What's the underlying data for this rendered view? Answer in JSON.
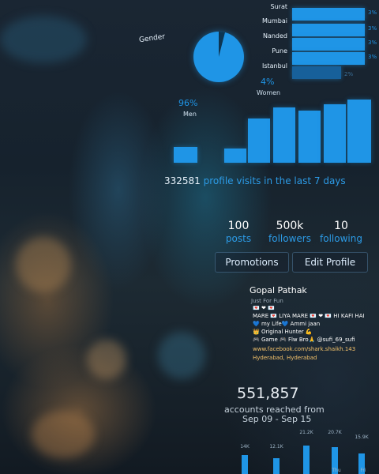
{
  "audience": {
    "gender_title": "Gender",
    "men_pct": "96%",
    "men_label": "Men",
    "women_pct": "4%",
    "women_label": "Women",
    "cities": [
      {
        "name": "Surat",
        "pct": "3%",
        "value": 3
      },
      {
        "name": "Mumbai",
        "pct": "3%",
        "value": 3
      },
      {
        "name": "Nanded",
        "pct": "3%",
        "value": 3
      },
      {
        "name": "Pune",
        "pct": "3%",
        "value": 3
      },
      {
        "name": "Istanbul",
        "pct": "2%",
        "value": 2
      }
    ]
  },
  "visits": {
    "count": "332581",
    "label": "profile visits in the last 7 days"
  },
  "stats": [
    {
      "value": "100",
      "label": "posts"
    },
    {
      "value": "500k",
      "label": "followers"
    },
    {
      "value": "10",
      "label": "following"
    }
  ],
  "buttons": {
    "promotions": "Promotions",
    "edit_profile": "Edit Profile"
  },
  "profile": {
    "name": "Gopal Pathak",
    "tagline": "Just For Fun",
    "bio_lines": [
      "💌 ❤ 💌",
      "MARE 💌 LIYA MARE 💌 ❤ 💌 HI KAFI HAI",
      "💙 my Life💙 Ammi jaan",
      "👑 Original Hunter 💪",
      "🎮 Game 🎮 Flw Bro🙏 @sufi_69_sufi"
    ],
    "link": "www.facebook.com/shark.shaikh.143",
    "location": "Hyderabad, Hyderabad"
  },
  "reach": {
    "count": "551,857",
    "label": "accounts reached from",
    "range": "Sep 09 - Sep 15"
  },
  "reach_bars": {
    "labels": [
      "14K",
      "12.1K",
      "21.2K",
      "20.7K",
      "15.9K"
    ],
    "values": [
      14,
      12.1,
      21.2,
      20.7,
      15.9
    ],
    "days": [
      "",
      "",
      "",
      "Thu",
      "Fri"
    ]
  }
}
